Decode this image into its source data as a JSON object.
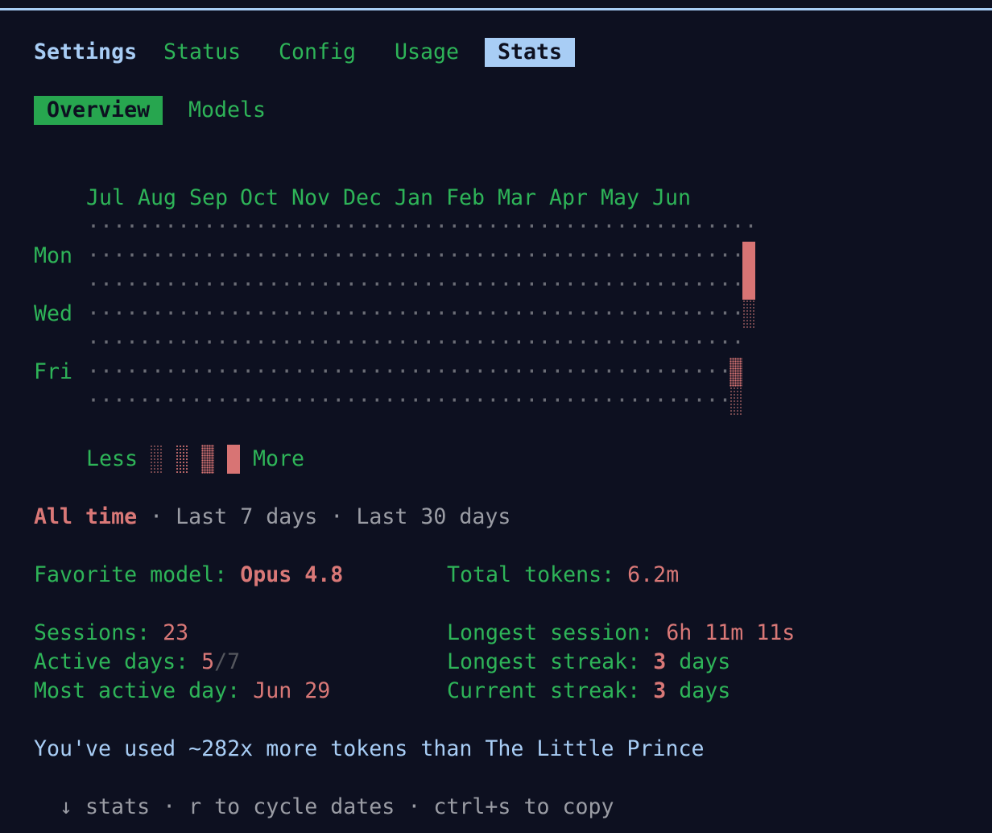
{
  "tabs": {
    "settings": "Settings",
    "items": [
      "Status",
      "Config",
      "Usage",
      "Stats"
    ],
    "active": "Stats"
  },
  "subtabs": {
    "items": [
      "Overview",
      "Models"
    ],
    "active": "Overview"
  },
  "heatmap": {
    "months": [
      "Jul",
      "Aug",
      "Sep",
      "Oct",
      "Nov",
      "Dec",
      "Jan",
      "Feb",
      "Mar",
      "Apr",
      "May",
      "Jun"
    ],
    "day_labels": {
      "mon": "Mon",
      "wed": "Wed",
      "fri": "Fri"
    },
    "legend": {
      "less": "Less",
      "more": "More"
    },
    "active_cells": [
      {
        "week": "last",
        "day": "Mon",
        "level": 4
      },
      {
        "week": "last",
        "day": "Tue",
        "level": 4
      },
      {
        "week": "last",
        "day": "Wed",
        "level": 1
      },
      {
        "week": "second-to-last",
        "day": "Fri",
        "level": 3
      },
      {
        "week": "second-to-last",
        "day": "Sat",
        "level": 1
      }
    ],
    "colors": {
      "accent": "#d87474",
      "empty_dot": "#6b6d76"
    }
  },
  "range": {
    "all_time": "All time",
    "last_7": "Last 7 days",
    "last_30": "Last 30 days",
    "sep": "·"
  },
  "stats": {
    "favorite_model_label": "Favorite model: ",
    "favorite_model_value": "Opus 4.8",
    "total_tokens_label": "Total tokens: ",
    "total_tokens_value": "6.2m",
    "sessions_label": "Sessions: ",
    "sessions_value": "23",
    "longest_session_label": "Longest session: ",
    "longest_session_value": "6h 11m 11s",
    "active_days_label": "Active days: ",
    "active_days_value": "5",
    "active_days_total": "/7",
    "longest_streak_label": "Longest streak: ",
    "longest_streak_value": "3",
    "streak_unit": " days",
    "most_active_day_label": "Most active day: ",
    "most_active_day_value": "Jun 29",
    "current_streak_label": "Current streak: ",
    "current_streak_value": "3"
  },
  "fun_fact": "You've used ~282x more tokens than The Little Prince",
  "footer": {
    "arrow": "↓",
    "stats": "stats",
    "sep": "·",
    "cycle": "r to cycle dates",
    "copy": "ctrl+s to copy"
  },
  "theme": {
    "background": "#0d1020",
    "green": "#2eb458",
    "blue": "#a8cdf5",
    "salmon": "#d97877",
    "gray": "#9a9ca4"
  }
}
